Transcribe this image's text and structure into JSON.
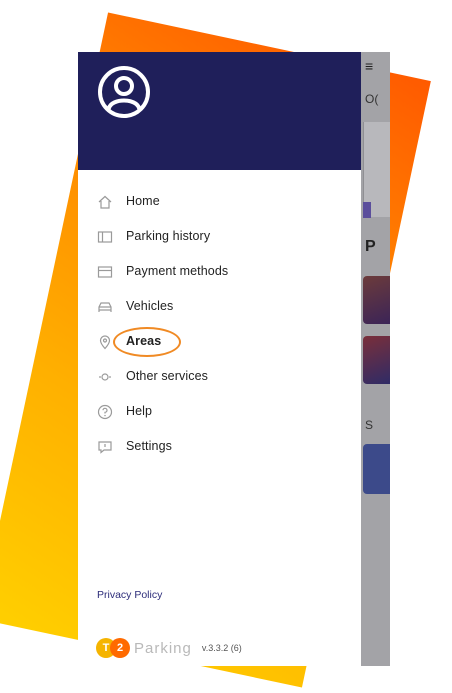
{
  "background_app": {
    "menu_glyph": "≡",
    "fragment_top": "O(",
    "fragment_section": "P",
    "fragment_s": "S"
  },
  "drawer": {
    "avatar_icon": "user-circle-icon",
    "items": [
      {
        "label": "Home",
        "icon": "home-icon"
      },
      {
        "label": "Parking history",
        "icon": "ticket-icon"
      },
      {
        "label": "Payment methods",
        "icon": "card-icon"
      },
      {
        "label": "Vehicles",
        "icon": "car-icon"
      },
      {
        "label": "Areas",
        "icon": "location-pin-icon",
        "highlighted": true
      },
      {
        "label": "Other services",
        "icon": "services-icon"
      },
      {
        "label": "Help",
        "icon": "help-icon"
      },
      {
        "label": "Settings",
        "icon": "chat-icon"
      }
    ],
    "privacy_label": "Privacy Policy",
    "brand": {
      "logo_t": "T",
      "logo_2": "2",
      "name": "Parking",
      "version": "v.3.3.2 (6)"
    }
  },
  "colors": {
    "header": "#1f1f5a",
    "accent_orange": "#f08a24",
    "privacy_link": "#2d2d7a"
  }
}
